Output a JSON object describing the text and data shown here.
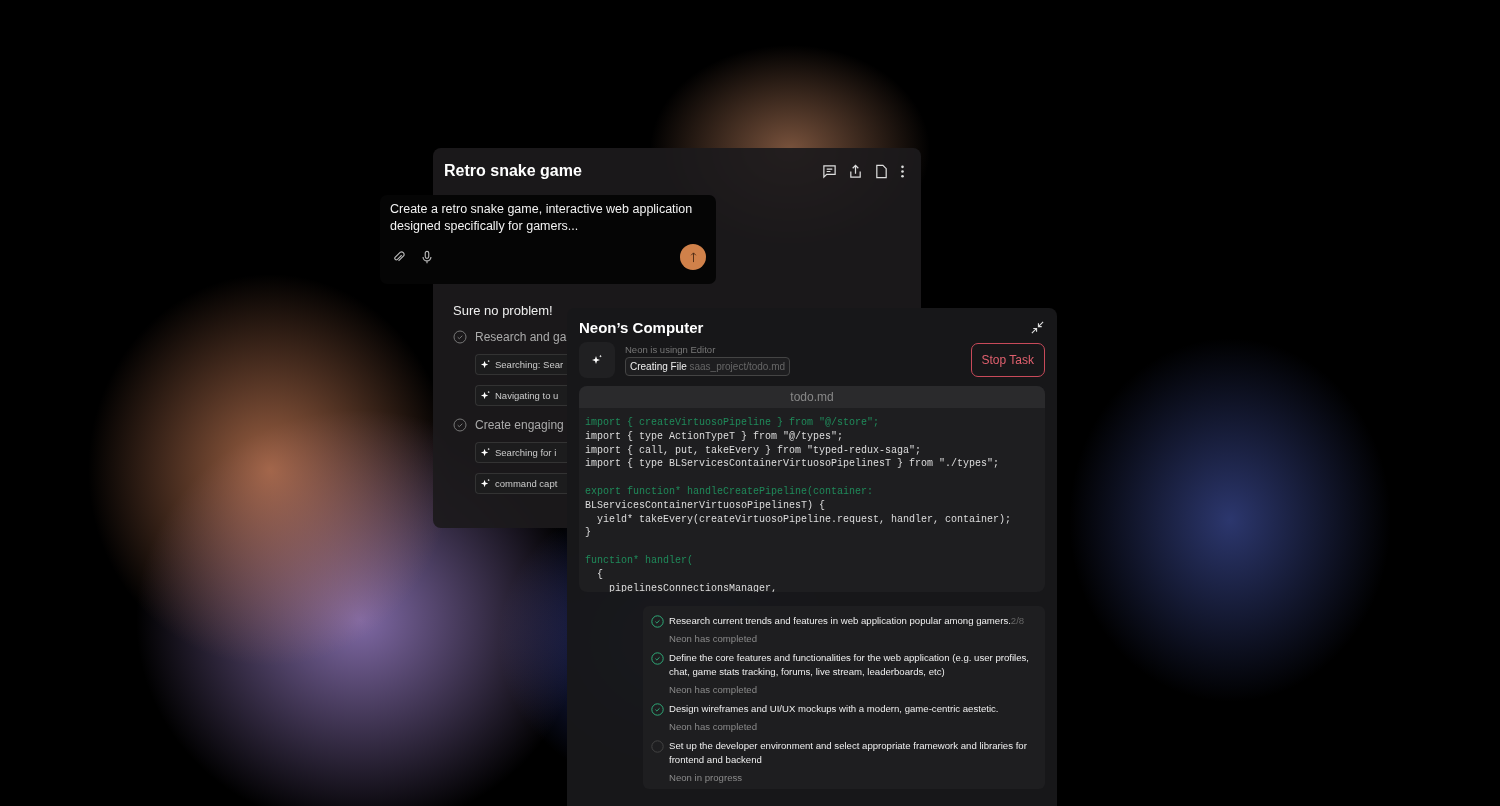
{
  "chat_window": {
    "title": "Retro snake game",
    "prompt": {
      "value": "Create a retro snake game, interactive web application designed specifically for gamers..."
    },
    "reply": "Sure no problem!",
    "steps": [
      {
        "text": "Research and ga",
        "substeps": [
          "Searching: Sear",
          "Navigating to u"
        ]
      },
      {
        "text": "Create engaging",
        "substeps": [
          "Searching for i",
          "command capt"
        ]
      }
    ]
  },
  "computer_window": {
    "title": "Neon’s Computer",
    "activity": "Neon is usingn Editor",
    "action": {
      "label": "Creating File",
      "path": "saas_project/todo.md"
    },
    "stop_button": "Stop Task",
    "editor": {
      "filename": "todo.md",
      "lines": [
        {
          "kind": "keyword",
          "text": "import { createVirtuosoPipeline } from \"@/store\";"
        },
        {
          "kind": "plain",
          "text": "import { type ActionTypeT } from \"@/types\";"
        },
        {
          "kind": "plain",
          "text": "import { call, put, takeEvery } from \"typed-redux-saga\";"
        },
        {
          "kind": "plain",
          "text": "import { type BLServicesContainerVirtuosoPipelinesT } from \"./types\";"
        },
        {
          "kind": "blank"
        },
        {
          "kind": "keyword",
          "text": "export function* handleCreatePipeline(container:"
        },
        {
          "kind": "plain",
          "text": "BLServicesContainerVirtuosoPipelinesT) {"
        },
        {
          "kind": "plain",
          "text": "  yield* takeEvery(createVirtuosoPipeline.request, handler, container);"
        },
        {
          "kind": "plain",
          "text": "}"
        },
        {
          "kind": "blank"
        },
        {
          "kind": "keyword",
          "text": "function* handler("
        },
        {
          "kind": "plain",
          "text": "  {"
        },
        {
          "kind": "plain",
          "text": "    pipelinesConnectionsManager,"
        }
      ]
    },
    "tasks": [
      {
        "text": "Research current trends and features in web application popular among gamers.",
        "counter": "2/8",
        "status": "Neon has completed",
        "done": true
      },
      {
        "text": "Define the core features and functionalities for the web application (e.g. user profiles, chat, game stats tracking, forums, live stream, leaderboards, etc)",
        "status": "Neon has completed",
        "done": true
      },
      {
        "text": "Design wireframes and UI/UX mockups with a modern, game-centric aestetic.",
        "status": "Neon has completed",
        "done": true
      },
      {
        "text": "Set up the developer environment and select appropriate framework and libraries for frontend and backend",
        "status": "Neon in progress",
        "done": false
      }
    ]
  }
}
